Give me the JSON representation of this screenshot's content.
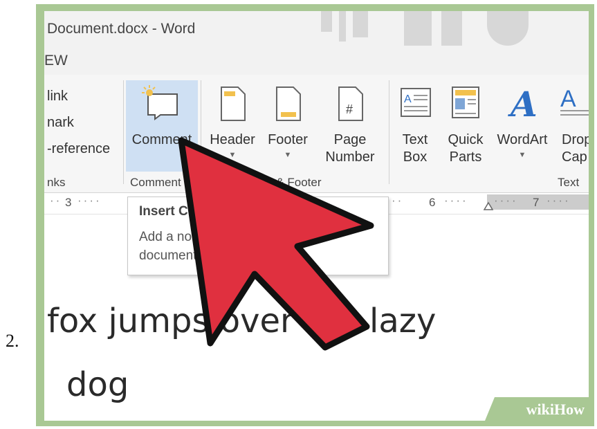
{
  "step_number": "2.",
  "window": {
    "title": "Document.docx - Word"
  },
  "ribbon_tab": {
    "label": "EW"
  },
  "links_group": {
    "items": [
      "link",
      "nark",
      "-reference"
    ],
    "label": "nks"
  },
  "comments_group": {
    "button_label": "Comment",
    "label": "Comment"
  },
  "header_footer_group": {
    "header_label": "Header",
    "footer_label": "Footer",
    "page_number_line1": "Page",
    "page_number_line2": "Number",
    "label": "der & Footer"
  },
  "text_group": {
    "textbox_line1": "Text",
    "textbox_line2": "Box",
    "quickparts_line1": "Quick",
    "quickparts_line2": "Parts",
    "wordart_label": "WordArt",
    "dropcap_line1": "Drop",
    "dropcap_line2": "Cap",
    "label": "Text"
  },
  "ruler": {
    "numbers": [
      "3",
      "6",
      "7"
    ]
  },
  "tooltip": {
    "title": "Insert C",
    "body_line1": "Add a no",
    "body_line2": "document."
  },
  "document": {
    "line1": "fox jumps over the lazy",
    "line2": "dog"
  },
  "watermark": {
    "brand": "wikiHow"
  },
  "colors": {
    "frame": "#a9c894",
    "cursor_fill": "#e0303f",
    "ribbon_active": "#cfe0f3",
    "wordart_blue": "#2e6fc4"
  }
}
